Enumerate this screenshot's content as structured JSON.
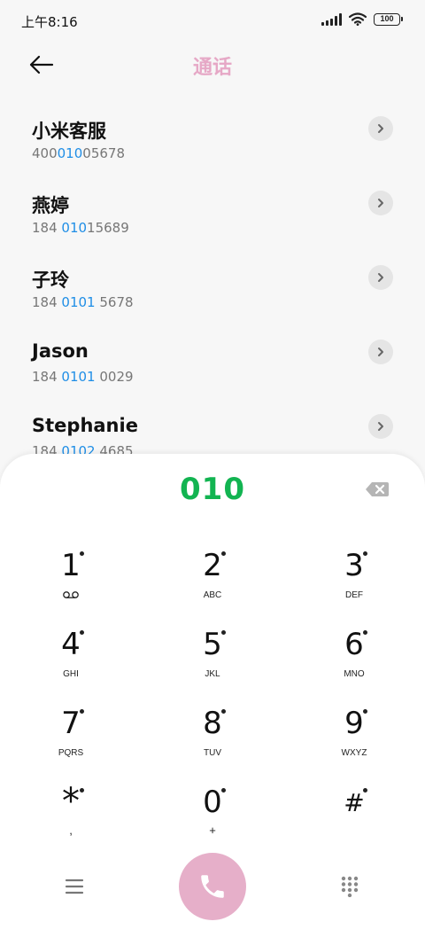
{
  "status_bar": {
    "time": "上午8:16",
    "battery": "100"
  },
  "header": {
    "title": "通话"
  },
  "contacts": [
    {
      "name": "小米客服",
      "num_pre": "400",
      "num_hl": "010",
      "num_post": "05678"
    },
    {
      "name": "燕婷",
      "num_pre": "184 ",
      "num_hl": "010",
      "num_post": "15689"
    },
    {
      "name": "子玲",
      "num_pre": "184 ",
      "num_hl": "0101",
      "num_post": " 5678"
    },
    {
      "name": "Jason",
      "num_pre": "184 ",
      "num_hl": "0101",
      "num_post": " 0029"
    },
    {
      "name": "Stephanie",
      "num_pre": "184 ",
      "num_hl": "0102",
      "num_post": " 4685"
    }
  ],
  "dialer": {
    "display": "010",
    "keys": [
      {
        "digit": "1",
        "letters": ""
      },
      {
        "digit": "2",
        "letters": "ABC"
      },
      {
        "digit": "3",
        "letters": "DEF"
      },
      {
        "digit": "4",
        "letters": "GHI"
      },
      {
        "digit": "5",
        "letters": "JKL"
      },
      {
        "digit": "6",
        "letters": "MNO"
      },
      {
        "digit": "7",
        "letters": "PQRS"
      },
      {
        "digit": "8",
        "letters": "TUV"
      },
      {
        "digit": "9",
        "letters": "WXYZ"
      },
      {
        "digit": "*",
        "letters": ","
      },
      {
        "digit": "0",
        "letters": "+"
      },
      {
        "digit": "#",
        "letters": ""
      }
    ]
  },
  "colors": {
    "accent_pink": "#e6a8c6",
    "call_button": "#e6afc9",
    "highlight_blue": "#1f8ee6",
    "dial_green": "#12b451"
  },
  "icons": {
    "back": "arrow-left-icon",
    "detail": "chevron-right-icon",
    "backspace": "backspace-icon",
    "voicemail": "voicemail-icon",
    "menu": "menu-icon",
    "call": "phone-icon",
    "dialpad": "dialpad-icon"
  }
}
